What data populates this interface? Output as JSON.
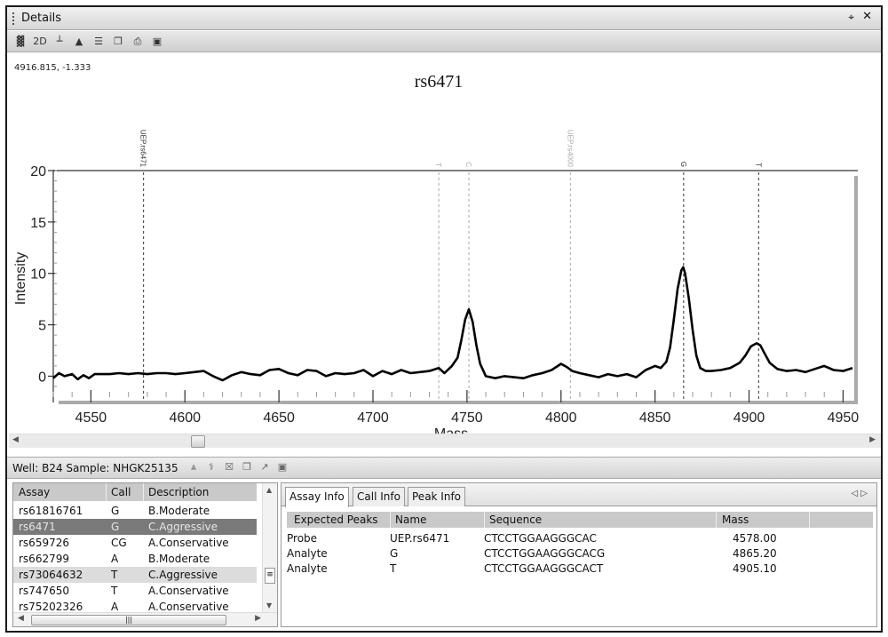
{
  "window": {
    "title": "Details",
    "pin_icon": "⌖",
    "close_icon": "✕"
  },
  "toolbar": {
    "buttons": [
      {
        "name": "spectrum-view",
        "glyph": "▓"
      },
      {
        "name": "2d-view",
        "glyph": "2D"
      },
      {
        "name": "bar-view",
        "glyph": "┴"
      },
      {
        "name": "peak-view",
        "glyph": "▲"
      },
      {
        "name": "list-view",
        "glyph": "☰"
      },
      {
        "name": "copy",
        "glyph": "❐"
      },
      {
        "name": "print",
        "glyph": "⎙"
      },
      {
        "name": "save",
        "glyph": "▣"
      }
    ]
  },
  "coord_readout": "4916.815, -1.333",
  "chart_data": {
    "type": "line",
    "title": "rs6471",
    "xlabel": "Mass",
    "ylabel": "Intensity",
    "xlim": [
      4530,
      4955
    ],
    "ylim": [
      -1,
      20
    ],
    "xticks": [
      4550,
      4600,
      4650,
      4700,
      4750,
      4800,
      4850,
      4900,
      4950
    ],
    "yticks": [
      0,
      5,
      10,
      15,
      20
    ],
    "markers": [
      {
        "label": "UEP.rs6471",
        "x": 4578.0,
        "style": "dark"
      },
      {
        "label": "T",
        "x": 4735.0,
        "style": "light"
      },
      {
        "label": "C",
        "x": 4751.0,
        "style": "light"
      },
      {
        "label": "UEP.rs4000",
        "x": 4805.0,
        "style": "light"
      },
      {
        "label": "G",
        "x": 4865.2,
        "style": "dark"
      },
      {
        "label": "T",
        "x": 4905.1,
        "style": "dark"
      }
    ],
    "series": [
      {
        "name": "spectrum",
        "x": [
          4530,
          4533,
          4536,
          4540,
          4543,
          4546,
          4549,
          4552,
          4555,
          4560,
          4565,
          4570,
          4575,
          4580,
          4585,
          4590,
          4595,
          4600,
          4605,
          4610,
          4615,
          4620,
          4625,
          4630,
          4635,
          4640,
          4645,
          4650,
          4655,
          4660,
          4665,
          4670,
          4675,
          4680,
          4685,
          4690,
          4695,
          4700,
          4705,
          4710,
          4715,
          4720,
          4725,
          4730,
          4735,
          4738,
          4742,
          4745,
          4747,
          4749,
          4751,
          4753,
          4755,
          4757,
          4760,
          4765,
          4770,
          4775,
          4780,
          4785,
          4790,
          4795,
          4800,
          4803,
          4806,
          4810,
          4815,
          4820,
          4825,
          4830,
          4835,
          4840,
          4845,
          4850,
          4853,
          4856,
          4858,
          4860,
          4862,
          4864,
          4865,
          4866,
          4868,
          4870,
          4872,
          4874,
          4877,
          4880,
          4885,
          4890,
          4895,
          4898,
          4901,
          4904,
          4906,
          4908,
          4911,
          4915,
          4920,
          4925,
          4930,
          4935,
          4940,
          4945,
          4950,
          4955
        ],
        "y": [
          -0.2,
          0.3,
          0.0,
          0.2,
          -0.3,
          0.1,
          -0.2,
          0.2,
          0.2,
          0.2,
          0.3,
          0.2,
          0.3,
          0.2,
          0.3,
          0.3,
          0.2,
          0.3,
          0.4,
          0.5,
          0.0,
          -0.4,
          0.1,
          0.4,
          0.2,
          0.1,
          0.6,
          0.7,
          0.3,
          0.1,
          0.6,
          0.5,
          0.0,
          0.3,
          0.2,
          0.3,
          0.6,
          0.0,
          0.5,
          0.2,
          0.6,
          0.3,
          0.4,
          0.5,
          0.8,
          0.3,
          1.0,
          1.8,
          3.5,
          5.5,
          6.5,
          5.3,
          3.0,
          1.2,
          0.0,
          -0.2,
          0.0,
          -0.1,
          -0.2,
          0.1,
          0.3,
          0.6,
          1.2,
          0.9,
          0.5,
          0.3,
          0.1,
          -0.1,
          0.2,
          0.0,
          0.2,
          -0.1,
          0.6,
          1.0,
          0.8,
          1.4,
          2.8,
          5.5,
          8.5,
          10.3,
          10.6,
          10.0,
          7.5,
          4.5,
          2.0,
          0.8,
          0.5,
          0.5,
          0.6,
          0.8,
          1.3,
          2.0,
          2.9,
          3.2,
          3.0,
          2.3,
          1.3,
          0.7,
          0.5,
          0.6,
          0.4,
          0.7,
          1.0,
          0.6,
          0.5,
          0.8
        ]
      }
    ]
  },
  "lower": {
    "well_label": "Well: B24 Sample: NHGK25135",
    "icons": [
      "filter-icon",
      "dna-icon",
      "delete-icon",
      "copy-icon",
      "chart-icon",
      "save-icon"
    ],
    "icon_glyphs": [
      "⩓",
      "⚕",
      "☒",
      "❐",
      "↗",
      "▣"
    ],
    "assay_table": {
      "columns": [
        "Assay",
        "Call",
        "Description"
      ],
      "rows": [
        {
          "assay": "rs61816761",
          "call": "G",
          "description": "B.Moderate"
        },
        {
          "assay": "rs6471",
          "call": "G",
          "description": "C.Aggressive",
          "selected": true
        },
        {
          "assay": "rs659726",
          "call": "CG",
          "description": "A.Conservative"
        },
        {
          "assay": "rs662799",
          "call": "A",
          "description": "B.Moderate"
        },
        {
          "assay": "rs73064632",
          "call": "T",
          "description": "C.Aggressive",
          "highlight": true
        },
        {
          "assay": "rs747650",
          "call": "T",
          "description": "A.Conservative"
        },
        {
          "assay": "rs75202326",
          "call": "A",
          "description": "A.Conservative"
        }
      ]
    },
    "tabs": [
      "Assay Info",
      "Call Info",
      "Peak Info"
    ],
    "active_tab": "Assay Info",
    "assay_info": {
      "columns": [
        "Expected Peaks",
        "Name",
        "Sequence",
        "Mass"
      ],
      "rows": [
        {
          "peak": "Probe",
          "name": "UEP.rs6471",
          "sequence": "CTCCTGGAAGGGCAC",
          "mass": "4578.00"
        },
        {
          "peak": "Analyte",
          "name": "G",
          "sequence": "CTCCTGGAAGGGCACG",
          "mass": "4865.20"
        },
        {
          "peak": "Analyte",
          "name": "T",
          "sequence": "CTCCTGGAAGGGCACT",
          "mass": "4905.10"
        }
      ]
    }
  }
}
